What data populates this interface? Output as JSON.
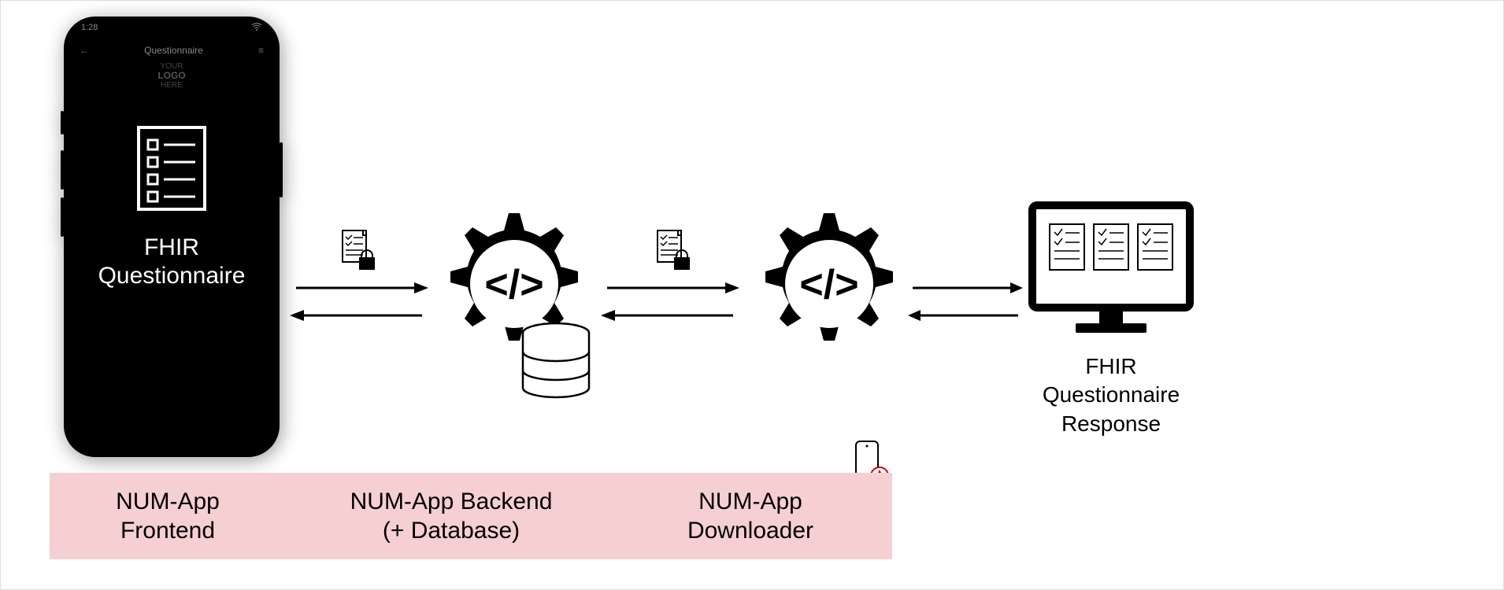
{
  "phone": {
    "status_time": "1:28",
    "nav_title": "Questionnaire",
    "logo_line1": "YOUR",
    "logo_line2": "LOGO",
    "logo_line3": "HERE",
    "fhir_line1": "FHIR",
    "fhir_line2": "Questionnaire"
  },
  "arrows": {
    "a1_top_dir": "right",
    "a1_bot_dir": "left",
    "a2_top_dir": "right",
    "a2_bot_dir": "left",
    "a3_top_dir": "right",
    "a3_bot_dir": "left"
  },
  "monitor": {
    "label_line1": "FHIR",
    "label_line2": "Questionnaire",
    "label_line3": "Response"
  },
  "labels": {
    "frontend_line1": "NUM-App",
    "frontend_line2": "Frontend",
    "backend_line1": "NUM-App Backend",
    "backend_line2": "(+ Database)",
    "downloader_line1": "NUM-App",
    "downloader_line2": "Downloader"
  },
  "icons": {
    "secure_doc": "encrypted-document",
    "gear_code": "gear-with-code",
    "db": "database-cylinder",
    "monitor": "desktop-monitor",
    "mini_phone": "mobile-with-compass"
  }
}
